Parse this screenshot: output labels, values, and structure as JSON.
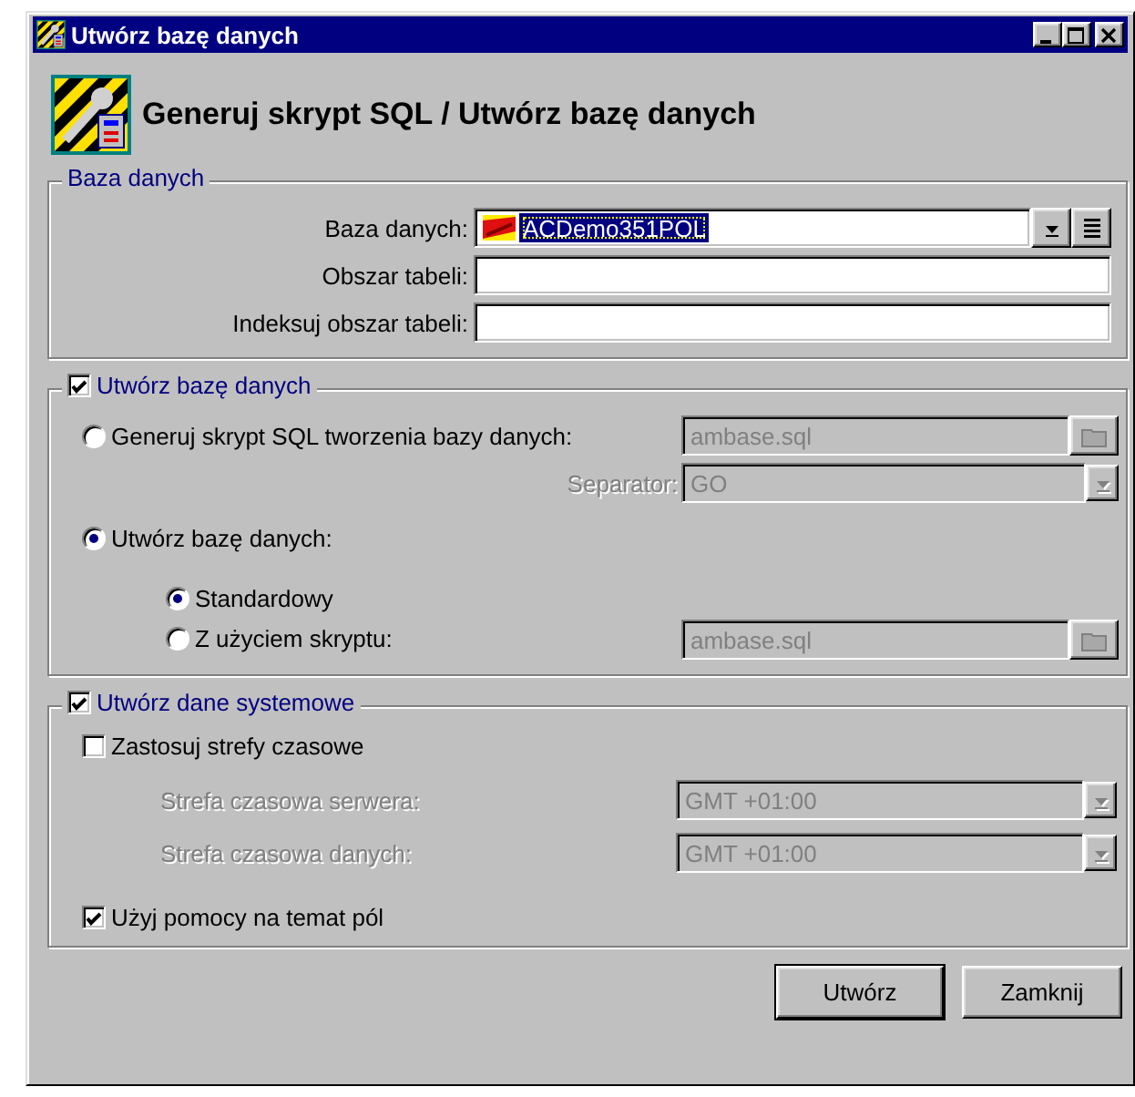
{
  "window": {
    "title": "Utwórz bazę danych"
  },
  "header": {
    "title": "Generuj skrypt SQL / Utwórz bazę danych"
  },
  "database_group": {
    "title": "Baza danych",
    "fields": [
      {
        "label": "Baza danych:",
        "kind": "combo",
        "value": "ACDemo351POL",
        "selected": true
      },
      {
        "label": "Obszar tabeli:",
        "kind": "text"
      },
      {
        "label": "Indeksuj obszar tabeli:",
        "kind": "text"
      }
    ]
  },
  "create_group": {
    "title": "Utwórz bazę danych",
    "checked": true,
    "script_option": {
      "label": "Generuj skrypt SQL tworzenia bazy danych:",
      "selected": false,
      "file": "ambase.sql",
      "disabled": true,
      "separator_label": "Separator:",
      "separator": "GO"
    },
    "create_option": {
      "label": "Utwórz bazę danych:",
      "selected": true
    },
    "suboptions": [
      {
        "label": "Standardowy",
        "selected": true
      },
      {
        "label": "Z użyciem skryptu:",
        "selected": false,
        "file": "ambase.sql",
        "disabled": true
      }
    ]
  },
  "system_group": {
    "title": "Utwórz dane systemowe",
    "checked": true,
    "timezones": {
      "label": "Zastosuj strefy czasowe",
      "checked": false
    },
    "timezone_fields": [
      {
        "label": "Strefa czasowa serwera:",
        "value": "GMT +01:00",
        "disabled": true
      },
      {
        "label": "Strefa czasowa danych:",
        "value": "GMT +01:00",
        "disabled": true
      }
    ],
    "field_help": {
      "label": "Użyj pomocy na temat pól",
      "checked": true
    }
  },
  "buttons": [
    {
      "label": "Utwórz",
      "default": true
    },
    {
      "label": "Zamknij",
      "default": false
    }
  ]
}
